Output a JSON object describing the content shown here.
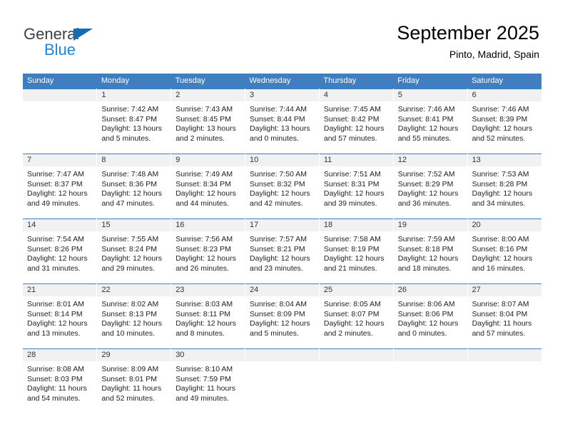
{
  "brand": {
    "name_top": "General",
    "name_bottom": "Blue",
    "accent_color": "#0f6cb6",
    "accent_color_light": "#1a87dc"
  },
  "header": {
    "title": "September 2025",
    "subtitle": "Pinto, Madrid, Spain"
  },
  "theme": {
    "header_bg": "#3f7fc1",
    "daynum_bg": "#f1f1f1"
  },
  "weekdays": [
    "Sunday",
    "Monday",
    "Tuesday",
    "Wednesday",
    "Thursday",
    "Friday",
    "Saturday"
  ],
  "weeks": [
    [
      {
        "day": "",
        "empty": true
      },
      {
        "day": "1",
        "sunrise": "Sunrise: 7:42 AM",
        "sunset": "Sunset: 8:47 PM",
        "daylight_1": "Daylight: 13 hours",
        "daylight_2": "and 5 minutes."
      },
      {
        "day": "2",
        "sunrise": "Sunrise: 7:43 AM",
        "sunset": "Sunset: 8:45 PM",
        "daylight_1": "Daylight: 13 hours",
        "daylight_2": "and 2 minutes."
      },
      {
        "day": "3",
        "sunrise": "Sunrise: 7:44 AM",
        "sunset": "Sunset: 8:44 PM",
        "daylight_1": "Daylight: 13 hours",
        "daylight_2": "and 0 minutes."
      },
      {
        "day": "4",
        "sunrise": "Sunrise: 7:45 AM",
        "sunset": "Sunset: 8:42 PM",
        "daylight_1": "Daylight: 12 hours",
        "daylight_2": "and 57 minutes."
      },
      {
        "day": "5",
        "sunrise": "Sunrise: 7:46 AM",
        "sunset": "Sunset: 8:41 PM",
        "daylight_1": "Daylight: 12 hours",
        "daylight_2": "and 55 minutes."
      },
      {
        "day": "6",
        "sunrise": "Sunrise: 7:46 AM",
        "sunset": "Sunset: 8:39 PM",
        "daylight_1": "Daylight: 12 hours",
        "daylight_2": "and 52 minutes."
      }
    ],
    [
      {
        "day": "7",
        "sunrise": "Sunrise: 7:47 AM",
        "sunset": "Sunset: 8:37 PM",
        "daylight_1": "Daylight: 12 hours",
        "daylight_2": "and 49 minutes."
      },
      {
        "day": "8",
        "sunrise": "Sunrise: 7:48 AM",
        "sunset": "Sunset: 8:36 PM",
        "daylight_1": "Daylight: 12 hours",
        "daylight_2": "and 47 minutes."
      },
      {
        "day": "9",
        "sunrise": "Sunrise: 7:49 AM",
        "sunset": "Sunset: 8:34 PM",
        "daylight_1": "Daylight: 12 hours",
        "daylight_2": "and 44 minutes."
      },
      {
        "day": "10",
        "sunrise": "Sunrise: 7:50 AM",
        "sunset": "Sunset: 8:32 PM",
        "daylight_1": "Daylight: 12 hours",
        "daylight_2": "and 42 minutes."
      },
      {
        "day": "11",
        "sunrise": "Sunrise: 7:51 AM",
        "sunset": "Sunset: 8:31 PM",
        "daylight_1": "Daylight: 12 hours",
        "daylight_2": "and 39 minutes."
      },
      {
        "day": "12",
        "sunrise": "Sunrise: 7:52 AM",
        "sunset": "Sunset: 8:29 PM",
        "daylight_1": "Daylight: 12 hours",
        "daylight_2": "and 36 minutes."
      },
      {
        "day": "13",
        "sunrise": "Sunrise: 7:53 AM",
        "sunset": "Sunset: 8:28 PM",
        "daylight_1": "Daylight: 12 hours",
        "daylight_2": "and 34 minutes."
      }
    ],
    [
      {
        "day": "14",
        "sunrise": "Sunrise: 7:54 AM",
        "sunset": "Sunset: 8:26 PM",
        "daylight_1": "Daylight: 12 hours",
        "daylight_2": "and 31 minutes."
      },
      {
        "day": "15",
        "sunrise": "Sunrise: 7:55 AM",
        "sunset": "Sunset: 8:24 PM",
        "daylight_1": "Daylight: 12 hours",
        "daylight_2": "and 29 minutes."
      },
      {
        "day": "16",
        "sunrise": "Sunrise: 7:56 AM",
        "sunset": "Sunset: 8:23 PM",
        "daylight_1": "Daylight: 12 hours",
        "daylight_2": "and 26 minutes."
      },
      {
        "day": "17",
        "sunrise": "Sunrise: 7:57 AM",
        "sunset": "Sunset: 8:21 PM",
        "daylight_1": "Daylight: 12 hours",
        "daylight_2": "and 23 minutes."
      },
      {
        "day": "18",
        "sunrise": "Sunrise: 7:58 AM",
        "sunset": "Sunset: 8:19 PM",
        "daylight_1": "Daylight: 12 hours",
        "daylight_2": "and 21 minutes."
      },
      {
        "day": "19",
        "sunrise": "Sunrise: 7:59 AM",
        "sunset": "Sunset: 8:18 PM",
        "daylight_1": "Daylight: 12 hours",
        "daylight_2": "and 18 minutes."
      },
      {
        "day": "20",
        "sunrise": "Sunrise: 8:00 AM",
        "sunset": "Sunset: 8:16 PM",
        "daylight_1": "Daylight: 12 hours",
        "daylight_2": "and 16 minutes."
      }
    ],
    [
      {
        "day": "21",
        "sunrise": "Sunrise: 8:01 AM",
        "sunset": "Sunset: 8:14 PM",
        "daylight_1": "Daylight: 12 hours",
        "daylight_2": "and 13 minutes."
      },
      {
        "day": "22",
        "sunrise": "Sunrise: 8:02 AM",
        "sunset": "Sunset: 8:13 PM",
        "daylight_1": "Daylight: 12 hours",
        "daylight_2": "and 10 minutes."
      },
      {
        "day": "23",
        "sunrise": "Sunrise: 8:03 AM",
        "sunset": "Sunset: 8:11 PM",
        "daylight_1": "Daylight: 12 hours",
        "daylight_2": "and 8 minutes."
      },
      {
        "day": "24",
        "sunrise": "Sunrise: 8:04 AM",
        "sunset": "Sunset: 8:09 PM",
        "daylight_1": "Daylight: 12 hours",
        "daylight_2": "and 5 minutes."
      },
      {
        "day": "25",
        "sunrise": "Sunrise: 8:05 AM",
        "sunset": "Sunset: 8:07 PM",
        "daylight_1": "Daylight: 12 hours",
        "daylight_2": "and 2 minutes."
      },
      {
        "day": "26",
        "sunrise": "Sunrise: 8:06 AM",
        "sunset": "Sunset: 8:06 PM",
        "daylight_1": "Daylight: 12 hours",
        "daylight_2": "and 0 minutes."
      },
      {
        "day": "27",
        "sunrise": "Sunrise: 8:07 AM",
        "sunset": "Sunset: 8:04 PM",
        "daylight_1": "Daylight: 11 hours",
        "daylight_2": "and 57 minutes."
      }
    ],
    [
      {
        "day": "28",
        "sunrise": "Sunrise: 8:08 AM",
        "sunset": "Sunset: 8:03 PM",
        "daylight_1": "Daylight: 11 hours",
        "daylight_2": "and 54 minutes."
      },
      {
        "day": "29",
        "sunrise": "Sunrise: 8:09 AM",
        "sunset": "Sunset: 8:01 PM",
        "daylight_1": "Daylight: 11 hours",
        "daylight_2": "and 52 minutes."
      },
      {
        "day": "30",
        "sunrise": "Sunrise: 8:10 AM",
        "sunset": "Sunset: 7:59 PM",
        "daylight_1": "Daylight: 11 hours",
        "daylight_2": "and 49 minutes."
      },
      {
        "day": "",
        "empty": true
      },
      {
        "day": "",
        "empty": true
      },
      {
        "day": "",
        "empty": true
      },
      {
        "day": "",
        "empty": true
      }
    ]
  ]
}
